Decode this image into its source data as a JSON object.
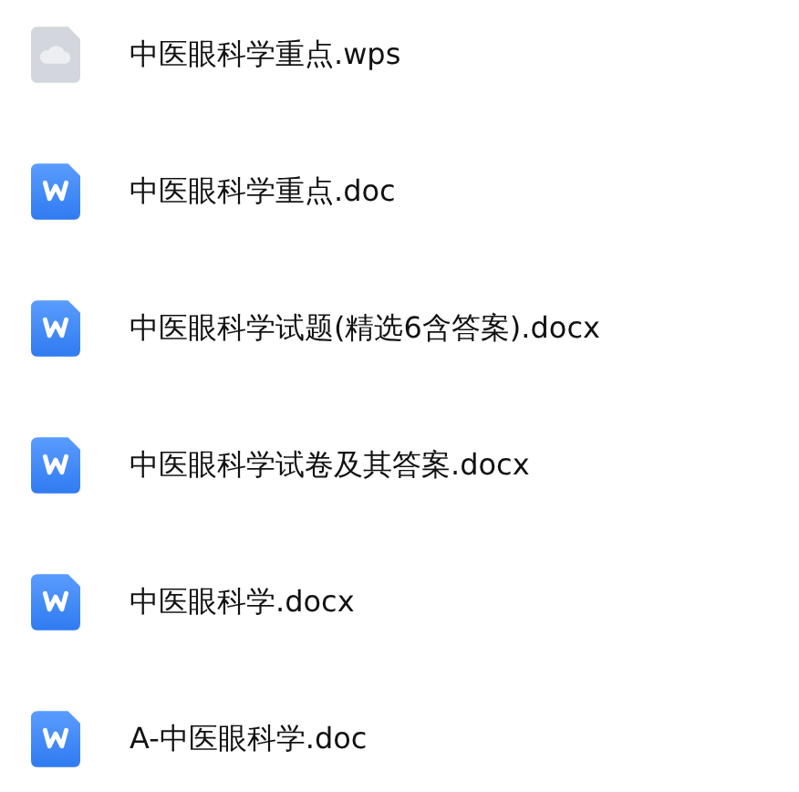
{
  "files": [
    {
      "kind": "cloud",
      "name": "中医眼科学重点.wps"
    },
    {
      "kind": "word",
      "name": "中医眼科学重点.doc"
    },
    {
      "kind": "word",
      "name": "中医眼科学试题(精选6含答案).docx"
    },
    {
      "kind": "word",
      "name": "中医眼科学试卷及其答案.docx"
    },
    {
      "kind": "word",
      "name": "中医眼科学.docx"
    },
    {
      "kind": "word",
      "name": "A-中医眼科学.doc"
    }
  ]
}
